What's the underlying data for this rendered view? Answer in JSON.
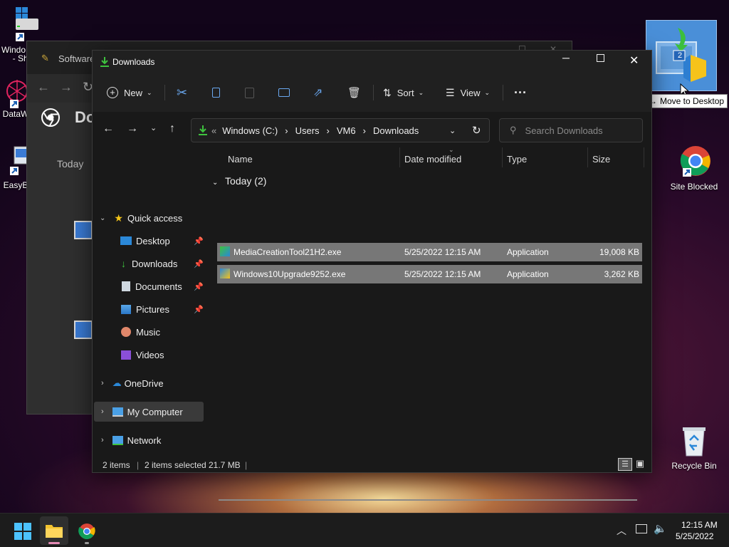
{
  "desktop": {
    "icons": [
      {
        "label": "Windo",
        "label2": "- Sho"
      },
      {
        "label": "DataW"
      },
      {
        "label": "EasyB"
      },
      {
        "label": "Site Blocked"
      },
      {
        "label": "Recycle Bin"
      }
    ],
    "drag_badge": "2",
    "drag_tooltip": "Move to Desktop"
  },
  "bg_window": {
    "title": "Software",
    "header_text": "Do",
    "today_label": "Today"
  },
  "explorer": {
    "title": "Downloads",
    "toolbar": {
      "new": "New",
      "sort": "Sort",
      "view": "View",
      "more": "···"
    },
    "address": {
      "overflow": "«",
      "crumbs": [
        "Windows (C:)",
        "Users",
        "VM6",
        "Downloads"
      ]
    },
    "search_placeholder": "Search Downloads",
    "nav": {
      "quick_access": "Quick access",
      "items": [
        "Desktop",
        "Downloads",
        "Documents",
        "Pictures",
        "Music",
        "Videos"
      ],
      "onedrive": "OneDrive",
      "my_computer": "My Computer",
      "network": "Network"
    },
    "columns": [
      "Name",
      "Date modified",
      "Type",
      "Size"
    ],
    "group_label": "Today (2)",
    "files": [
      {
        "name": "MediaCreationTool21H2.exe",
        "date": "5/25/2022 12:15 AM",
        "type": "Application",
        "size": "19,008 KB"
      },
      {
        "name": "Windows10Upgrade9252.exe",
        "date": "5/25/2022 12:15 AM",
        "type": "Application",
        "size": "3,262 KB"
      }
    ],
    "status": {
      "count": "2 items",
      "selected": "2 items selected",
      "size": "21.7 MB"
    }
  },
  "taskbar": {
    "time": "12:15 AM",
    "date": "5/25/2022"
  },
  "colors": {
    "accent": "#0078d4",
    "selection": "#777777",
    "window_bg": "#191919"
  }
}
